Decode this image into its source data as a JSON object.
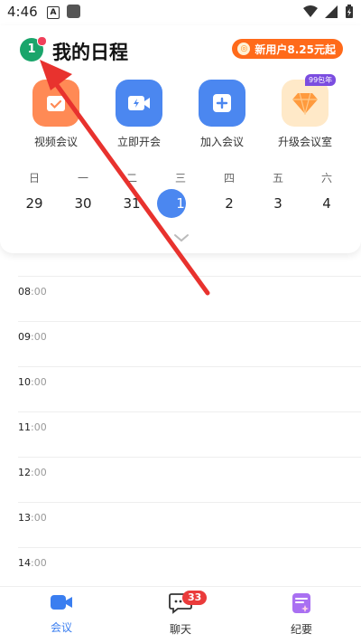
{
  "status": {
    "time": "4:46",
    "icon_a": "A"
  },
  "header": {
    "avatar_text": "1",
    "title": "我的日程",
    "promo": "新用户8.25元起",
    "promo_coin": "◎"
  },
  "actions": [
    {
      "label": "视频会议",
      "icon": "calendar-check-icon",
      "color": "#ff8a55"
    },
    {
      "label": "立即开会",
      "icon": "video-bolt-icon",
      "color": "#4b87f0"
    },
    {
      "label": "加入会议",
      "icon": "plus-icon",
      "color": "#4b87f0"
    },
    {
      "label": "升级会议室",
      "icon": "diamond-icon",
      "color": "#ffe9c8",
      "tag": "99包年"
    }
  ],
  "week": {
    "names": [
      "日",
      "一",
      "二",
      "三",
      "四",
      "五",
      "六"
    ],
    "dates": [
      "29",
      "30",
      "31",
      "1",
      "2",
      "3",
      "4"
    ],
    "selected_index": 3
  },
  "timeline": [
    {
      "h": "08",
      "m": ":00"
    },
    {
      "h": "09",
      "m": ":00"
    },
    {
      "h": "10",
      "m": ":00"
    },
    {
      "h": "11",
      "m": ":00"
    },
    {
      "h": "12",
      "m": ":00"
    },
    {
      "h": "13",
      "m": ":00"
    },
    {
      "h": "14",
      "m": ":00"
    }
  ],
  "tabs": [
    {
      "label": "会议",
      "icon": "video-camera-icon",
      "active": true
    },
    {
      "label": "聊天",
      "icon": "chat-bubble-icon",
      "badge": "33"
    },
    {
      "label": "纪要",
      "icon": "notes-sparkle-icon"
    }
  ],
  "colors": {
    "accent": "#4b87f0",
    "annotation_arrow": "#e8322e"
  }
}
